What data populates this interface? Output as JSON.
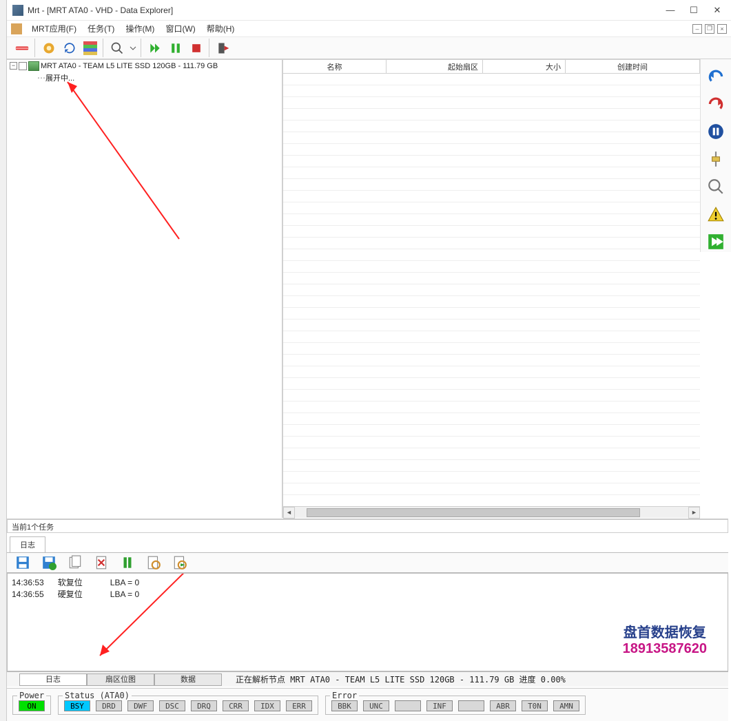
{
  "window": {
    "title": "Mrt - [MRT ATA0 - VHD - Data Explorer]"
  },
  "menu": {
    "app": "MRT应用(F)",
    "task": "任务(T)",
    "operate": "操作(M)",
    "window": "窗口(W)",
    "help": "帮助(H)"
  },
  "tree": {
    "root": "MRT ATA0 - TEAM L5 LITE SSD 120GB - 111.79 GB",
    "expanding": "展开中..."
  },
  "grid": {
    "headers": {
      "name": "名称",
      "start": "起始扇区",
      "size": "大小",
      "time": "创建时间"
    }
  },
  "task_bar": "当前1个任务",
  "log_tab": "日志",
  "log_lines": [
    {
      "time": "14:36:53",
      "op": "软复位",
      "lba": "LBA = 0"
    },
    {
      "time": "14:36:55",
      "op": "硬复位",
      "lba": "LBA = 0"
    }
  ],
  "watermark": {
    "line1": "盘首数据恢复",
    "line2": "18913587620"
  },
  "bottom_tabs": {
    "log": "日志",
    "sector": "扇区位图",
    "data": "数据"
  },
  "bottom_status": "正在解析节点 MRT ATA0 - TEAM L5 LITE SSD 120GB - 111.79 GB  进度 0.00%",
  "status": {
    "power_label": "Power",
    "power_value": "ON",
    "status_label": "Status (ATA0)",
    "status_flags": [
      "BSY",
      "DRD",
      "DWF",
      "DSC",
      "DRQ",
      "CRR",
      "IDX",
      "ERR"
    ],
    "error_label": "Error",
    "error_flags": [
      "BBK",
      "UNC",
      "",
      "INF",
      "",
      "ABR",
      "T0N",
      "AMN"
    ]
  }
}
